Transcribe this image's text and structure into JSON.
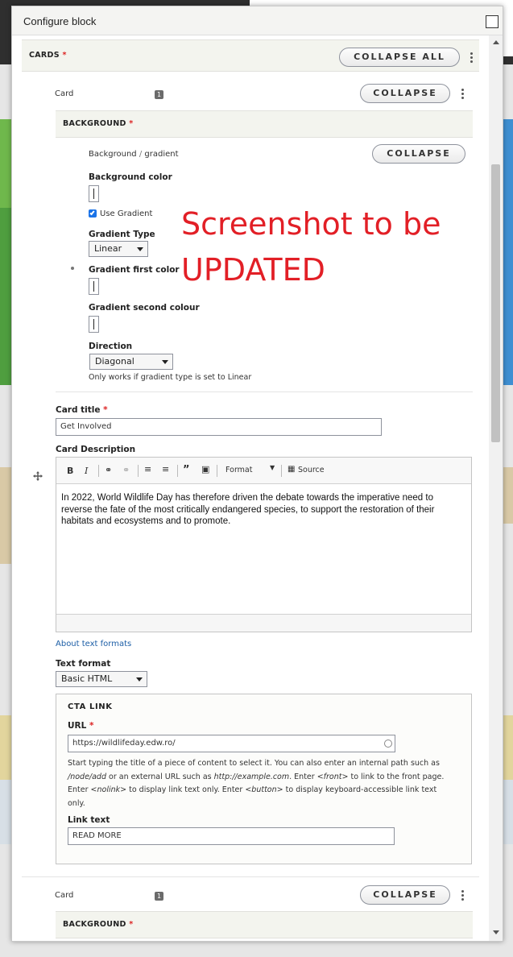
{
  "dialog": {
    "title": "Configure block"
  },
  "cards_section": {
    "label": "CARDS",
    "collapse_all_label": "COLLAPSE ALL"
  },
  "card": {
    "label": "Card",
    "badge": "1",
    "collapse_label": "COLLAPSE"
  },
  "background": {
    "label": "BACKGROUND",
    "subtitle_left": "Background",
    "subtitle_sep": "/",
    "subtitle_right": "gradient",
    "collapse_label": "COLLAPSE",
    "background_color_label": "Background color",
    "use_gradient_label": "Use Gradient",
    "use_gradient_checked": true,
    "gradient_type_label": "Gradient Type",
    "gradient_type_value": "Linear",
    "gradient_first_label": "Gradient first color",
    "gradient_second_label": "Gradient second colour",
    "direction_label": "Direction",
    "direction_value": "Diagonal",
    "direction_help": "Only works if gradient type is set to Linear"
  },
  "watermark": {
    "line1": "Screenshot to be",
    "line2": "UPDATED"
  },
  "card_title": {
    "label": "Card title",
    "value": "Get Involved"
  },
  "card_description": {
    "label": "Card Description",
    "toolbar": {
      "bold": "B",
      "italic": "I",
      "format": "Format",
      "source": "Source"
    },
    "body": "In 2022, World Wildlife Day has therefore driven the debate towards the imperative need to reverse the fate of the most critically endangered species, to support the restoration of their habitats and ecosystems and to promote."
  },
  "text_formats": {
    "about_link": "About text formats",
    "label": "Text format",
    "value": "Basic HTML"
  },
  "cta": {
    "legend": "CTA LINK",
    "url_label": "URL",
    "url_value": "https://wildlifeday.edw.ro/",
    "help": {
      "p1": "Start typing the title of a piece of content to select it. You can also enter an internal path such as",
      "p2": "/node/add",
      "p3": "or an external URL such as",
      "p4": "http://example.com",
      "p5": ". Enter",
      "p6": "<front>",
      "p7": "to link to the front page. Enter",
      "p8": "<nolink>",
      "p9": "to display link text only. Enter",
      "p10": "<button>",
      "p11": "to display keyboard-accessible link text only."
    },
    "link_text_label": "Link text",
    "link_text_value": "READ MORE"
  },
  "card2": {
    "label": "Card",
    "badge": "1",
    "collapse_label": "COLLAPSE",
    "background_label": "BACKGROUND"
  },
  "colors": {
    "required": "#dc2323",
    "watermark": "#e21f26",
    "link": "#1c5ea6"
  }
}
